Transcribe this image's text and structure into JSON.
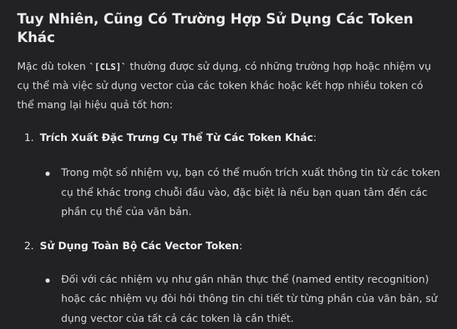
{
  "section": {
    "title": "Tuy Nhiên, Cũng Có Trường Hợp Sử Dụng Các Token Khác",
    "intro_before_code": "Mặc dù token ",
    "code_token": "`[CLS]`",
    "intro_after_code": " thường được sử dụng, có những trường hợp hoặc nhiệm vụ cụ thể mà việc sử dụng vector của các token khác hoặc kết hợp nhiều token có thể mang lại hiệu quả tốt hơn:"
  },
  "items": [
    {
      "number": "1.",
      "heading": "Trích Xuất Đặc Trưng Cụ Thể Từ Các Token Khác",
      "colon": ":",
      "bullet": "Trong một số nhiệm vụ, bạn có thể muốn trích xuất thông tin từ các token cụ thể khác trong chuỗi đầu vào, đặc biệt là nếu bạn quan tâm đến các phần cụ thể của văn bản."
    },
    {
      "number": "2.",
      "heading": "Sử Dụng Toàn Bộ Các Vector Token",
      "colon": ":",
      "bullet": "Đối với các nhiệm vụ như gán nhãn thực thể (named entity recognition) hoặc các nhiệm vụ đòi hỏi thông tin chi tiết từ từng phần của văn bản, sử dụng vector của tất cả các token là cần thiết."
    }
  ]
}
